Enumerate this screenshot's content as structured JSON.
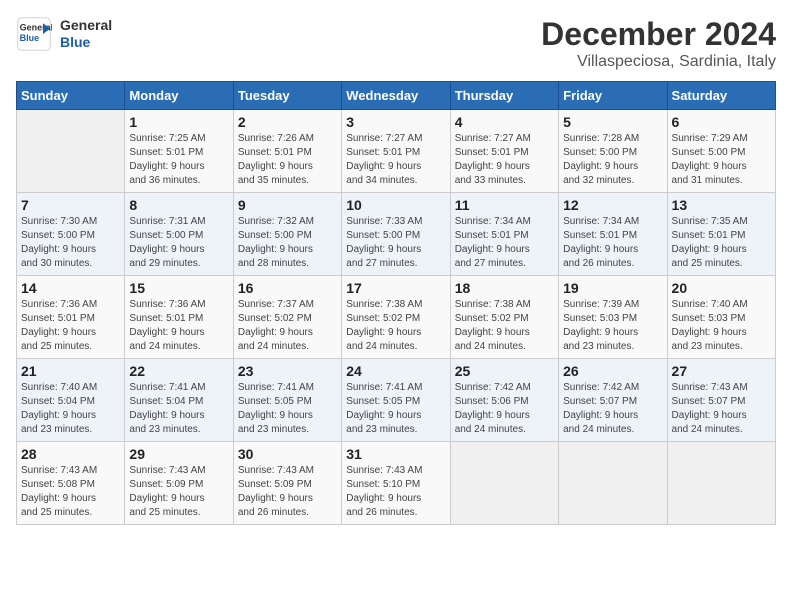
{
  "logo": {
    "line1": "General",
    "line2": "Blue"
  },
  "title": "December 2024",
  "subtitle": "Villaspeciosa, Sardinia, Italy",
  "weekdays": [
    "Sunday",
    "Monday",
    "Tuesday",
    "Wednesday",
    "Thursday",
    "Friday",
    "Saturday"
  ],
  "days": [
    {
      "num": "",
      "info": ""
    },
    {
      "num": "1",
      "info": "Sunrise: 7:25 AM\nSunset: 5:01 PM\nDaylight: 9 hours\nand 36 minutes."
    },
    {
      "num": "2",
      "info": "Sunrise: 7:26 AM\nSunset: 5:01 PM\nDaylight: 9 hours\nand 35 minutes."
    },
    {
      "num": "3",
      "info": "Sunrise: 7:27 AM\nSunset: 5:01 PM\nDaylight: 9 hours\nand 34 minutes."
    },
    {
      "num": "4",
      "info": "Sunrise: 7:27 AM\nSunset: 5:01 PM\nDaylight: 9 hours\nand 33 minutes."
    },
    {
      "num": "5",
      "info": "Sunrise: 7:28 AM\nSunset: 5:00 PM\nDaylight: 9 hours\nand 32 minutes."
    },
    {
      "num": "6",
      "info": "Sunrise: 7:29 AM\nSunset: 5:00 PM\nDaylight: 9 hours\nand 31 minutes."
    },
    {
      "num": "7",
      "info": "Sunrise: 7:30 AM\nSunset: 5:00 PM\nDaylight: 9 hours\nand 30 minutes."
    },
    {
      "num": "8",
      "info": "Sunrise: 7:31 AM\nSunset: 5:00 PM\nDaylight: 9 hours\nand 29 minutes."
    },
    {
      "num": "9",
      "info": "Sunrise: 7:32 AM\nSunset: 5:00 PM\nDaylight: 9 hours\nand 28 minutes."
    },
    {
      "num": "10",
      "info": "Sunrise: 7:33 AM\nSunset: 5:00 PM\nDaylight: 9 hours\nand 27 minutes."
    },
    {
      "num": "11",
      "info": "Sunrise: 7:34 AM\nSunset: 5:01 PM\nDaylight: 9 hours\nand 27 minutes."
    },
    {
      "num": "12",
      "info": "Sunrise: 7:34 AM\nSunset: 5:01 PM\nDaylight: 9 hours\nand 26 minutes."
    },
    {
      "num": "13",
      "info": "Sunrise: 7:35 AM\nSunset: 5:01 PM\nDaylight: 9 hours\nand 25 minutes."
    },
    {
      "num": "14",
      "info": "Sunrise: 7:36 AM\nSunset: 5:01 PM\nDaylight: 9 hours\nand 25 minutes."
    },
    {
      "num": "15",
      "info": "Sunrise: 7:36 AM\nSunset: 5:01 PM\nDaylight: 9 hours\nand 24 minutes."
    },
    {
      "num": "16",
      "info": "Sunrise: 7:37 AM\nSunset: 5:02 PM\nDaylight: 9 hours\nand 24 minutes."
    },
    {
      "num": "17",
      "info": "Sunrise: 7:38 AM\nSunset: 5:02 PM\nDaylight: 9 hours\nand 24 minutes."
    },
    {
      "num": "18",
      "info": "Sunrise: 7:38 AM\nSunset: 5:02 PM\nDaylight: 9 hours\nand 24 minutes."
    },
    {
      "num": "19",
      "info": "Sunrise: 7:39 AM\nSunset: 5:03 PM\nDaylight: 9 hours\nand 23 minutes."
    },
    {
      "num": "20",
      "info": "Sunrise: 7:40 AM\nSunset: 5:03 PM\nDaylight: 9 hours\nand 23 minutes."
    },
    {
      "num": "21",
      "info": "Sunrise: 7:40 AM\nSunset: 5:04 PM\nDaylight: 9 hours\nand 23 minutes."
    },
    {
      "num": "22",
      "info": "Sunrise: 7:41 AM\nSunset: 5:04 PM\nDaylight: 9 hours\nand 23 minutes."
    },
    {
      "num": "23",
      "info": "Sunrise: 7:41 AM\nSunset: 5:05 PM\nDaylight: 9 hours\nand 23 minutes."
    },
    {
      "num": "24",
      "info": "Sunrise: 7:41 AM\nSunset: 5:05 PM\nDaylight: 9 hours\nand 23 minutes."
    },
    {
      "num": "25",
      "info": "Sunrise: 7:42 AM\nSunset: 5:06 PM\nDaylight: 9 hours\nand 24 minutes."
    },
    {
      "num": "26",
      "info": "Sunrise: 7:42 AM\nSunset: 5:07 PM\nDaylight: 9 hours\nand 24 minutes."
    },
    {
      "num": "27",
      "info": "Sunrise: 7:43 AM\nSunset: 5:07 PM\nDaylight: 9 hours\nand 24 minutes."
    },
    {
      "num": "28",
      "info": "Sunrise: 7:43 AM\nSunset: 5:08 PM\nDaylight: 9 hours\nand 25 minutes."
    },
    {
      "num": "29",
      "info": "Sunrise: 7:43 AM\nSunset: 5:09 PM\nDaylight: 9 hours\nand 25 minutes."
    },
    {
      "num": "30",
      "info": "Sunrise: 7:43 AM\nSunset: 5:09 PM\nDaylight: 9 hours\nand 26 minutes."
    },
    {
      "num": "31",
      "info": "Sunrise: 7:43 AM\nSunset: 5:10 PM\nDaylight: 9 hours\nand 26 minutes."
    },
    {
      "num": "",
      "info": ""
    },
    {
      "num": "",
      "info": ""
    },
    {
      "num": "",
      "info": ""
    }
  ]
}
